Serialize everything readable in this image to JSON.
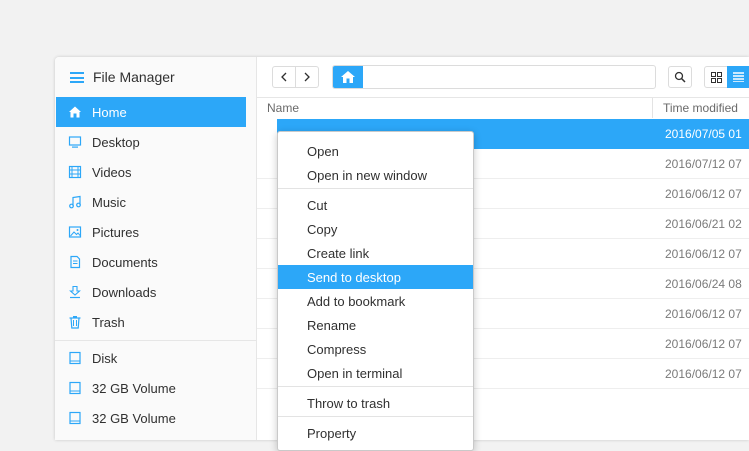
{
  "window": {
    "title": "File Manager"
  },
  "colors": {
    "accent": "#2ca7f8",
    "text": "#303030"
  },
  "sidebar": {
    "items": [
      {
        "label": "Home",
        "icon": "home-icon",
        "active": true
      },
      {
        "label": "Desktop",
        "icon": "desktop-icon"
      },
      {
        "label": "Videos",
        "icon": "film-icon"
      },
      {
        "label": "Music",
        "icon": "music-note-icon"
      },
      {
        "label": "Pictures",
        "icon": "picture-icon"
      },
      {
        "label": "Documents",
        "icon": "document-icon"
      },
      {
        "label": "Downloads",
        "icon": "download-icon"
      },
      {
        "label": "Trash",
        "icon": "trash-icon"
      }
    ],
    "devices": [
      {
        "label": "Disk",
        "icon": "drive-icon"
      },
      {
        "label": "32 GB Volume",
        "icon": "drive-icon"
      },
      {
        "label": "32 GB Volume",
        "icon": "drive-icon"
      }
    ]
  },
  "toolbar": {
    "back_icon": "chevron-left-icon",
    "forward_icon": "chevron-right-icon",
    "search_icon": "search-icon",
    "grid_icon": "grid-view-icon",
    "list_icon": "list-view-icon"
  },
  "columns": {
    "name": "Name",
    "time": "Time modified"
  },
  "rows": [
    {
      "time": "2016/07/05 01",
      "selected": true
    },
    {
      "time": "2016/07/12 07"
    },
    {
      "time": "2016/06/12 07"
    },
    {
      "time": "2016/06/21 02"
    },
    {
      "time": "2016/06/12 07"
    },
    {
      "time": "2016/06/24 08"
    },
    {
      "time": "2016/06/12 07"
    },
    {
      "time": "2016/06/12 07"
    },
    {
      "time": "2016/06/12 07"
    }
  ],
  "context_menu": {
    "items": [
      "Open",
      "Open in new window",
      "Cut",
      "Copy",
      "Create link",
      "Send to desktop",
      "Add to bookmark",
      "Rename",
      "Compress",
      "Open in terminal",
      "Throw to trash",
      "Property"
    ],
    "highlighted": "Send to desktop"
  }
}
